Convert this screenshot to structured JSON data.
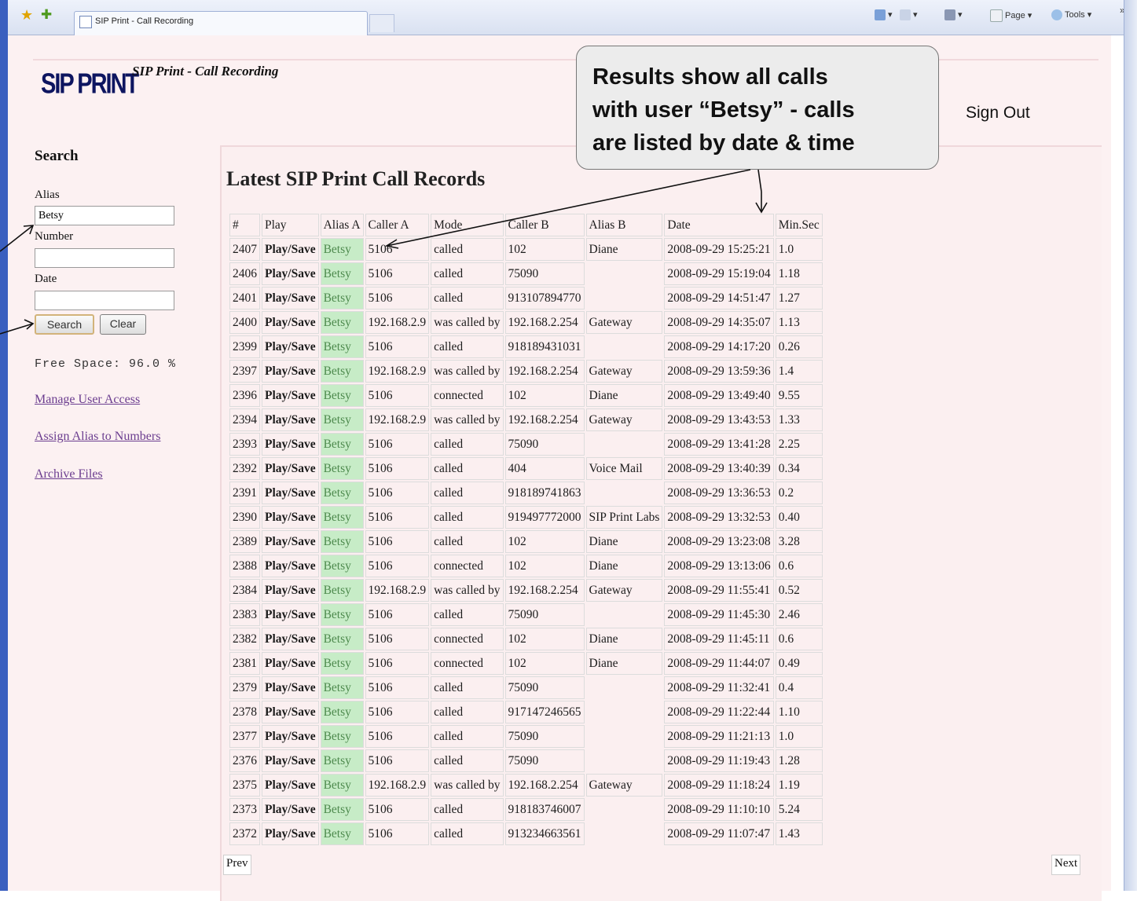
{
  "browser": {
    "tab_title": "SIP Print - Call Recording",
    "toolbar": {
      "page_menu": "Page",
      "tools_menu": "Tools"
    }
  },
  "header": {
    "logo_text": "SIP PRINT",
    "subtitle": "SIP Print - Call Recording",
    "sign_out": "Sign Out"
  },
  "sidebar": {
    "heading": "Search",
    "alias_label": "Alias",
    "alias_value": "Betsy",
    "number_label": "Number",
    "number_value": "",
    "date_label": "Date",
    "date_value": "",
    "search_button": "Search",
    "clear_button": "Clear",
    "free_space": "Free Space: 96.0 %",
    "links": [
      "Manage User Access",
      "Assign Alias to Numbers",
      "Archive Files"
    ]
  },
  "main": {
    "title": "Latest SIP Print Call Records",
    "columns": [
      "#",
      "Play",
      "Alias A",
      "Caller A",
      "Mode",
      "Caller B",
      "Alias B",
      "Date",
      "Min.Sec"
    ],
    "rows": [
      [
        "2407",
        "Play/Save",
        "Betsy",
        "5106",
        "called",
        "102",
        "Diane",
        "2008-09-29 15:25:21",
        "1.0"
      ],
      [
        "2406",
        "Play/Save",
        "Betsy",
        "5106",
        "called",
        "75090",
        "",
        "2008-09-29 15:19:04",
        "1.18"
      ],
      [
        "2401",
        "Play/Save",
        "Betsy",
        "5106",
        "called",
        "913107894770",
        "",
        "2008-09-29 14:51:47",
        "1.27"
      ],
      [
        "2400",
        "Play/Save",
        "Betsy",
        "192.168.2.9",
        "was called by",
        "192.168.2.254",
        "Gateway",
        "2008-09-29 14:35:07",
        "1.13"
      ],
      [
        "2399",
        "Play/Save",
        "Betsy",
        "5106",
        "called",
        "918189431031",
        "",
        "2008-09-29 14:17:20",
        "0.26"
      ],
      [
        "2397",
        "Play/Save",
        "Betsy",
        "192.168.2.9",
        "was called by",
        "192.168.2.254",
        "Gateway",
        "2008-09-29 13:59:36",
        "1.4"
      ],
      [
        "2396",
        "Play/Save",
        "Betsy",
        "5106",
        "connected",
        "102",
        "Diane",
        "2008-09-29 13:49:40",
        "9.55"
      ],
      [
        "2394",
        "Play/Save",
        "Betsy",
        "192.168.2.9",
        "was called by",
        "192.168.2.254",
        "Gateway",
        "2008-09-29 13:43:53",
        "1.33"
      ],
      [
        "2393",
        "Play/Save",
        "Betsy",
        "5106",
        "called",
        "75090",
        "",
        "2008-09-29 13:41:28",
        "2.25"
      ],
      [
        "2392",
        "Play/Save",
        "Betsy",
        "5106",
        "called",
        "404",
        "Voice Mail",
        "2008-09-29 13:40:39",
        "0.34"
      ],
      [
        "2391",
        "Play/Save",
        "Betsy",
        "5106",
        "called",
        "918189741863",
        "",
        "2008-09-29 13:36:53",
        "0.2"
      ],
      [
        "2390",
        "Play/Save",
        "Betsy",
        "5106",
        "called",
        "919497772000",
        "SIP Print Labs",
        "2008-09-29 13:32:53",
        "0.40"
      ],
      [
        "2389",
        "Play/Save",
        "Betsy",
        "5106",
        "called",
        "102",
        "Diane",
        "2008-09-29 13:23:08",
        "3.28"
      ],
      [
        "2388",
        "Play/Save",
        "Betsy",
        "5106",
        "connected",
        "102",
        "Diane",
        "2008-09-29 13:13:06",
        "0.6"
      ],
      [
        "2384",
        "Play/Save",
        "Betsy",
        "192.168.2.9",
        "was called by",
        "192.168.2.254",
        "Gateway",
        "2008-09-29 11:55:41",
        "0.52"
      ],
      [
        "2383",
        "Play/Save",
        "Betsy",
        "5106",
        "called",
        "75090",
        "",
        "2008-09-29 11:45:30",
        "2.46"
      ],
      [
        "2382",
        "Play/Save",
        "Betsy",
        "5106",
        "connected",
        "102",
        "Diane",
        "2008-09-29 11:45:11",
        "0.6"
      ],
      [
        "2381",
        "Play/Save",
        "Betsy",
        "5106",
        "connected",
        "102",
        "Diane",
        "2008-09-29 11:44:07",
        "0.49"
      ],
      [
        "2379",
        "Play/Save",
        "Betsy",
        "5106",
        "called",
        "75090",
        "",
        "2008-09-29 11:32:41",
        "0.4"
      ],
      [
        "2378",
        "Play/Save",
        "Betsy",
        "5106",
        "called",
        "917147246565",
        "",
        "2008-09-29 11:22:44",
        "1.10"
      ],
      [
        "2377",
        "Play/Save",
        "Betsy",
        "5106",
        "called",
        "75090",
        "",
        "2008-09-29 11:21:13",
        "1.0"
      ],
      [
        "2376",
        "Play/Save",
        "Betsy",
        "5106",
        "called",
        "75090",
        "",
        "2008-09-29 11:19:43",
        "1.28"
      ],
      [
        "2375",
        "Play/Save",
        "Betsy",
        "192.168.2.9",
        "was called by",
        "192.168.2.254",
        "Gateway",
        "2008-09-29 11:18:24",
        "1.19"
      ],
      [
        "2373",
        "Play/Save",
        "Betsy",
        "5106",
        "called",
        "918183746007",
        "",
        "2008-09-29 11:10:10",
        "5.24"
      ],
      [
        "2372",
        "Play/Save",
        "Betsy",
        "5106",
        "called",
        "913234663561",
        "",
        "2008-09-29 11:07:47",
        "1.43"
      ]
    ],
    "prev": "Prev",
    "next": "Next"
  },
  "callout": {
    "lines": [
      "Results show all calls",
      "with user “Betsy” - calls",
      "are listed by date & time"
    ]
  },
  "colors": {
    "page_bg": "#fcf1f2",
    "alias_highlight": "#c7ecc7",
    "link": "#6b3d8f",
    "logo": "#0d1560",
    "window_frame": "#3a5fbf"
  }
}
